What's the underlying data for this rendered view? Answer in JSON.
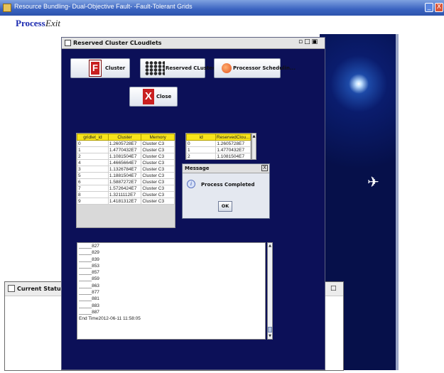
{
  "window": {
    "title": "Resource Bundling- Dual-Objective Fault- -Fault-Tolerant Grids",
    "min_glyph": "_",
    "close_glyph": "X"
  },
  "menu": {
    "items": [
      {
        "label": "Process"
      },
      {
        "label": "Exit"
      }
    ]
  },
  "status_frame": {
    "title": "Current Status of The P",
    "restore_glyph": "□"
  },
  "main_frame": {
    "title": "Reserved Cluster CLoudlets",
    "controls": "▫□▣"
  },
  "buttons": {
    "cluster": {
      "label": "Cluster",
      "glyph": "F"
    },
    "reserved_cluster": {
      "label": "Reserved CLuster..."
    },
    "processor_scheduling": {
      "label": "Processor Schedulin..."
    },
    "close": {
      "label": "Close",
      "glyph": "X"
    }
  },
  "table_clusters": {
    "columns": [
      "gridlet_id",
      "Cluster",
      "Memory"
    ],
    "rows": [
      [
        "0",
        "1.2605728E7",
        "Cluster C3"
      ],
      [
        "1",
        "1.4770432E7",
        "Cluster C3"
      ],
      [
        "2",
        "1.1081504E7",
        "Cluster C3"
      ],
      [
        "4",
        "1.4665664E7",
        "Cluster C3"
      ],
      [
        "3",
        "1.1326784E7",
        "Cluster C3"
      ],
      [
        "5",
        "1.1881504E7",
        "Cluster C3"
      ],
      [
        "6",
        "1.5887272E7",
        "Cluster C3"
      ],
      [
        "7",
        "1.5726424E7",
        "Cluster C3"
      ],
      [
        "8",
        "1.3211112E7",
        "Cluster C3"
      ],
      [
        "9",
        "1.4181312E7",
        "Cluster C3"
      ]
    ]
  },
  "table_reserved": {
    "columns": [
      "id",
      "ReservedClou..."
    ],
    "rows": [
      [
        "0",
        "1.2605728E7"
      ],
      [
        "1",
        "1.4770432E7"
      ],
      [
        "2",
        "1.1081504E7"
      ]
    ],
    "scroll_glyph": "▲"
  },
  "dialog": {
    "title": "Message",
    "close_glyph": "X",
    "info_glyph": "i",
    "message": "Process Completed",
    "ok_label": "OK"
  },
  "log": {
    "lines": [
      "_____827",
      "_____829",
      "_____839",
      "_____853",
      "_____857",
      "_____859",
      "_____863",
      "_____877",
      "_____881",
      "_____883",
      "_____887",
      "End Time2012-06-11 11:58:05"
    ],
    "up_glyph": "▲",
    "down_glyph": "▼"
  },
  "icons": {
    "space_figure": "✈"
  },
  "colors": {
    "frame_background": "#0c1058",
    "table_header": "#f7e41a",
    "title_bar": "#3a63c0"
  }
}
